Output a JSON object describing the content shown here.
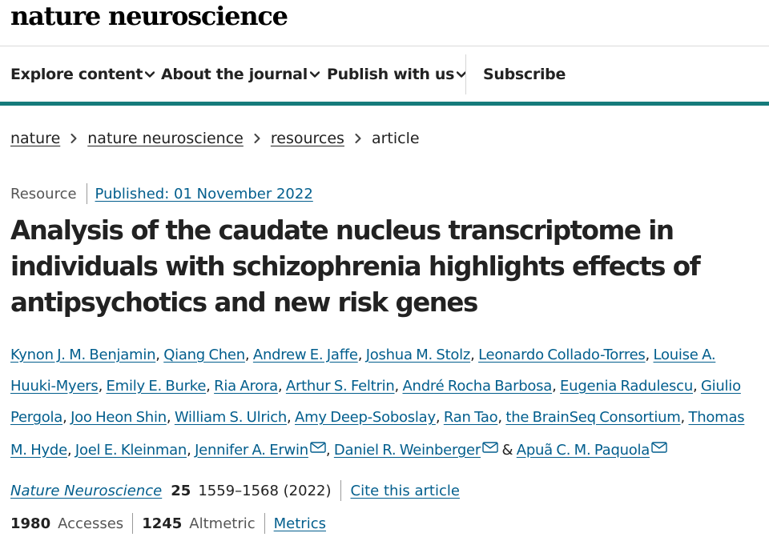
{
  "brand": {
    "logo": "nature neuroscience"
  },
  "nav": {
    "items": [
      {
        "label": "Explore content",
        "icon": "chevron-down-icon"
      },
      {
        "label": "About the journal",
        "icon": "chevron-down-icon"
      },
      {
        "label": "Publish with us",
        "icon": "chevron-down-icon"
      }
    ],
    "subscribe": "Subscribe",
    "accent_color": "#157b7b"
  },
  "breadcrumb": {
    "items": [
      "nature",
      "nature neuroscience",
      "resources"
    ],
    "current": "article"
  },
  "article": {
    "type": "Resource",
    "published": "Published: 01 November 2022",
    "title": "Analysis of the caudate nucleus transcriptome in individuals with schizophrenia highlights effects of antipsychotics and new risk genes",
    "authors": [
      "Kynon J. M. Benjamin",
      "Qiang Chen",
      "Andrew E. Jaffe",
      "Joshua M. Stolz",
      "Leonardo Collado-Torres",
      "Louise A. Huuki-Myers",
      "Emily E. Burke",
      "Ria Arora",
      "Arthur S. Feltrin",
      "André Rocha Barbosa",
      "Eugenia Radulescu",
      "Giulio Pergola",
      "Joo Heon Shin",
      "William S. Ulrich",
      "Amy Deep-Soboslay",
      "Ran Tao",
      "the BrainSeq Consortium",
      "Thomas M. Hyde",
      "Joel E. Kleinman",
      "Jennifer A. Erwin",
      "Daniel R. Weinberger",
      "Apuã C. M. Paquola"
    ],
    "authors_separator": ",",
    "authors_last_separator": "&",
    "corresponding_icon": "envelope-icon",
    "link_color": "#025e8d"
  },
  "citation": {
    "journal": "Nature Neuroscience",
    "volume": "25",
    "pages": "1559–1568 (2022)",
    "cite_link": "Cite this article"
  },
  "metrics": {
    "accesses_count": "1980",
    "accesses_label": "Accesses",
    "altmetric_count": "1245",
    "altmetric_label": "Altmetric",
    "metrics_link": "Metrics"
  }
}
